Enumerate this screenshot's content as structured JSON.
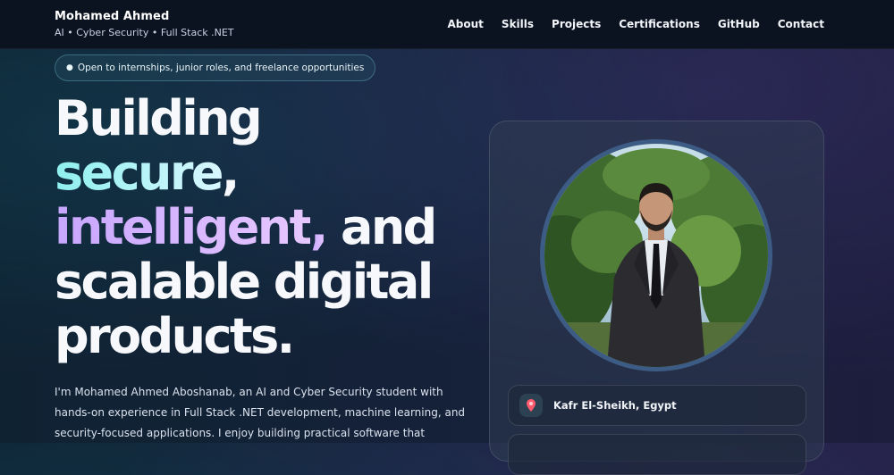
{
  "header": {
    "name": "Mohamed Ahmed",
    "tagline": "AI • Cyber Security • Full Stack .NET",
    "nav": [
      "About",
      "Skills",
      "Projects",
      "Certifications",
      "GitHub",
      "Contact"
    ]
  },
  "badge": {
    "dot": "●",
    "text": "Open to internships, junior roles, and freelance opportunities"
  },
  "hero": {
    "line1": "Building",
    "word_secure": "secure",
    "comma1": ",",
    "word_intelligent": "intelligent",
    "comma2": ",",
    "and": " and",
    "line4": "scalable digital",
    "line5": "products."
  },
  "intro": "I'm Mohamed Ahmed Aboshanab, an AI and Cyber Security student with hands-on experience in Full Stack .NET development, machine learning, and security-focused applications. I enjoy building practical software that",
  "profile": {
    "location_icon": "map-pin-icon",
    "location": "Kafr El-Sheikh, Egypt"
  },
  "colors": {
    "accent_cyan": "#8ef0ee",
    "accent_purple": "#c7a6ff",
    "portrait_ring": "#3c5c86"
  }
}
